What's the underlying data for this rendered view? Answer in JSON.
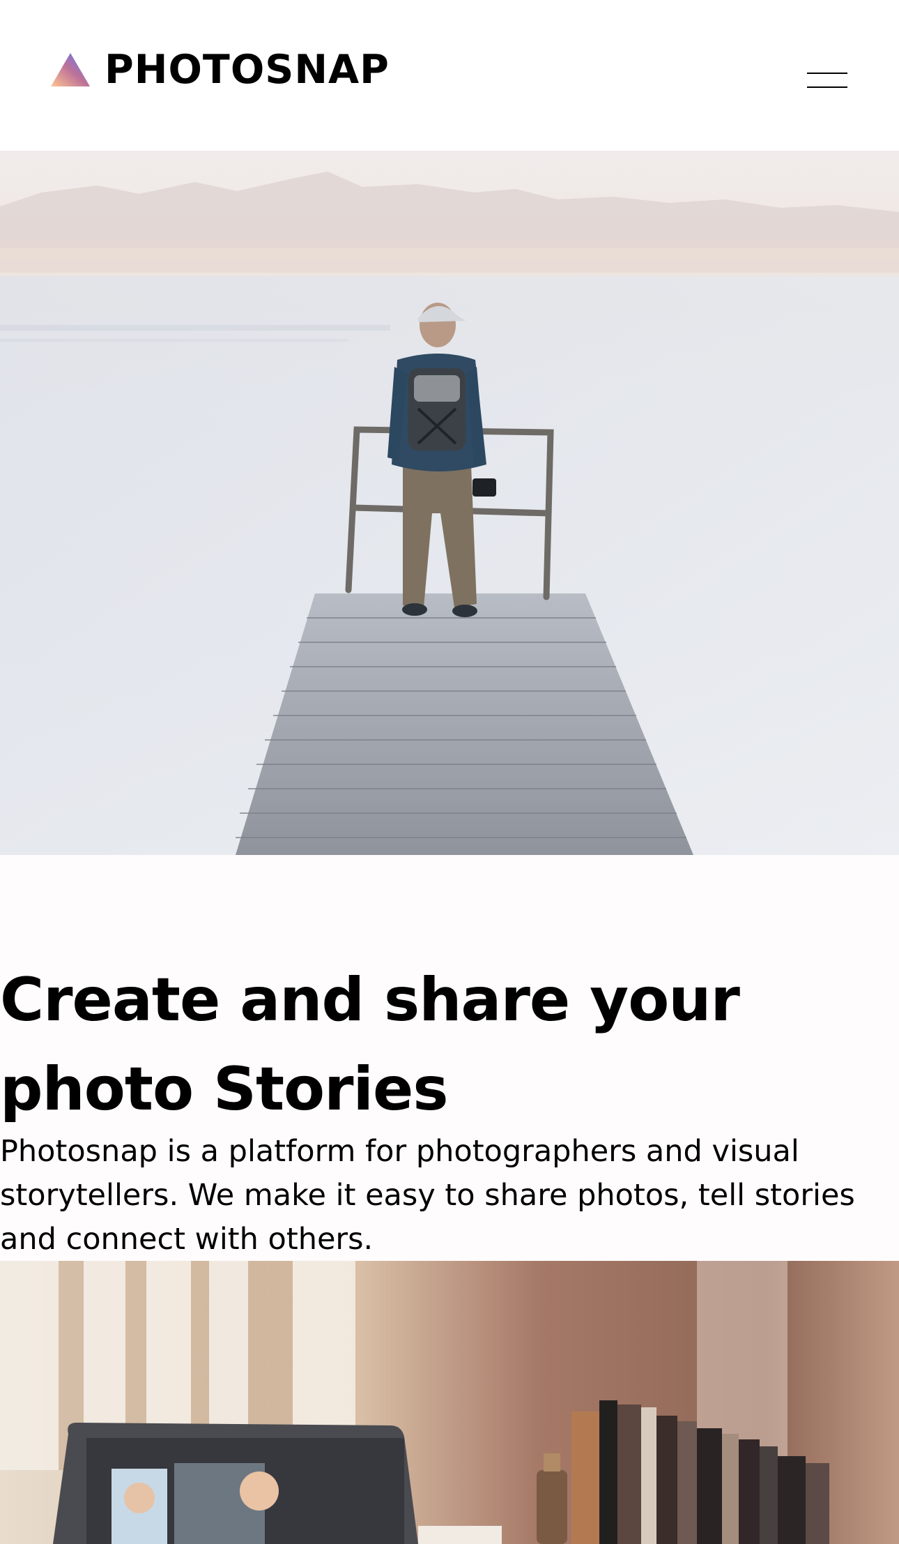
{
  "header": {
    "logo_text": "PHOTOSNAP",
    "logo_icon": "triangle-gradient-icon",
    "menu_icon": "hamburger-menu-icon"
  },
  "hero": {
    "image_name": "hero-photo"
  },
  "intro": {
    "title": "Create and share your photo Stories",
    "description": "Photosnap is a platform for photographers and visual storytellers. We make it easy to share photos, tell stories and connect with others."
  },
  "feature": {
    "image_name": "desk-laptop-photo"
  },
  "colors": {
    "background": "#fefcfc",
    "text": "#000000",
    "logo_gradient_start": "#ffc593",
    "logo_gradient_mid": "#bc7198",
    "logo_gradient_end": "#5a77ff"
  }
}
